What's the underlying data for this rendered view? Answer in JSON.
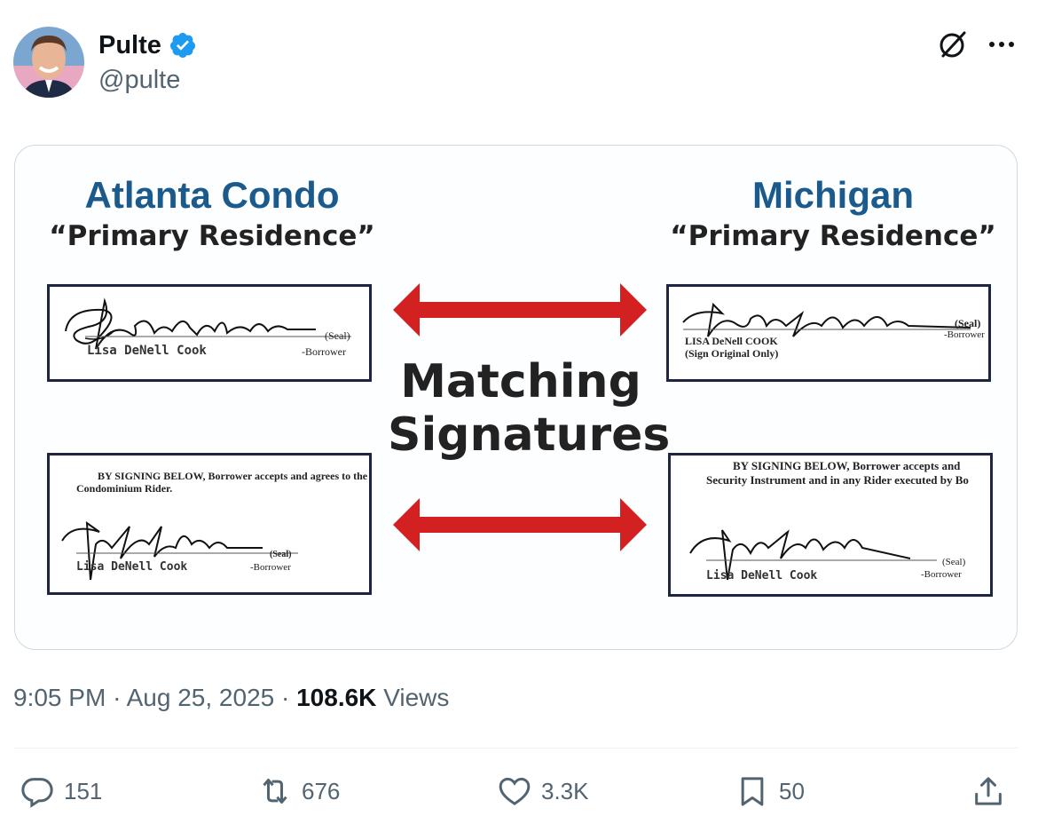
{
  "author": {
    "name": "Pulte",
    "handle": "@pulte",
    "verified": true,
    "avatar_icon": "profile-avatar",
    "verified_color": "#1d9bf0"
  },
  "media": {
    "left_title": "Atlanta Condo",
    "left_subtitle": "“Primary Residence”",
    "right_title": "Michigan",
    "right_subtitle": "“Primary Residence”",
    "center_line1": "Matching",
    "center_line2": "Signatures",
    "title_color": "#1b5a8c",
    "arrow_color": "#d32020",
    "doc1": {
      "typed_name": "Lisa DeNell Cook",
      "seal": "(Seal)",
      "role": "-Borrower"
    },
    "doc2": {
      "typed_name": "LISA DeNell COOK",
      "note": "(Sign Original Only)",
      "seal": "(Seal)",
      "role": "-Borrower"
    },
    "doc3": {
      "body_line1": "BY SIGNING BELOW, Borrower accepts and agrees to the",
      "body_line2": "Condominium Rider.",
      "typed_name": "Lisa DeNell Cook",
      "seal": "(Seal)",
      "role": "-Borrower"
    },
    "doc4": {
      "body_line1": "BY SIGNING BELOW, Borrower accepts and",
      "body_line2": "Security Instrument and in any Rider executed by Bo",
      "typed_name": "Lisa DeNell Cook",
      "seal": "(Seal)",
      "role": "-Borrower"
    }
  },
  "meta": {
    "time": "9:05 PM",
    "separator": "·",
    "date": "Aug 25, 2025",
    "views_count": "108.6K",
    "views_label": "Views"
  },
  "actions": {
    "replies": "151",
    "reposts": "676",
    "likes": "3.3K",
    "bookmarks": "50"
  }
}
